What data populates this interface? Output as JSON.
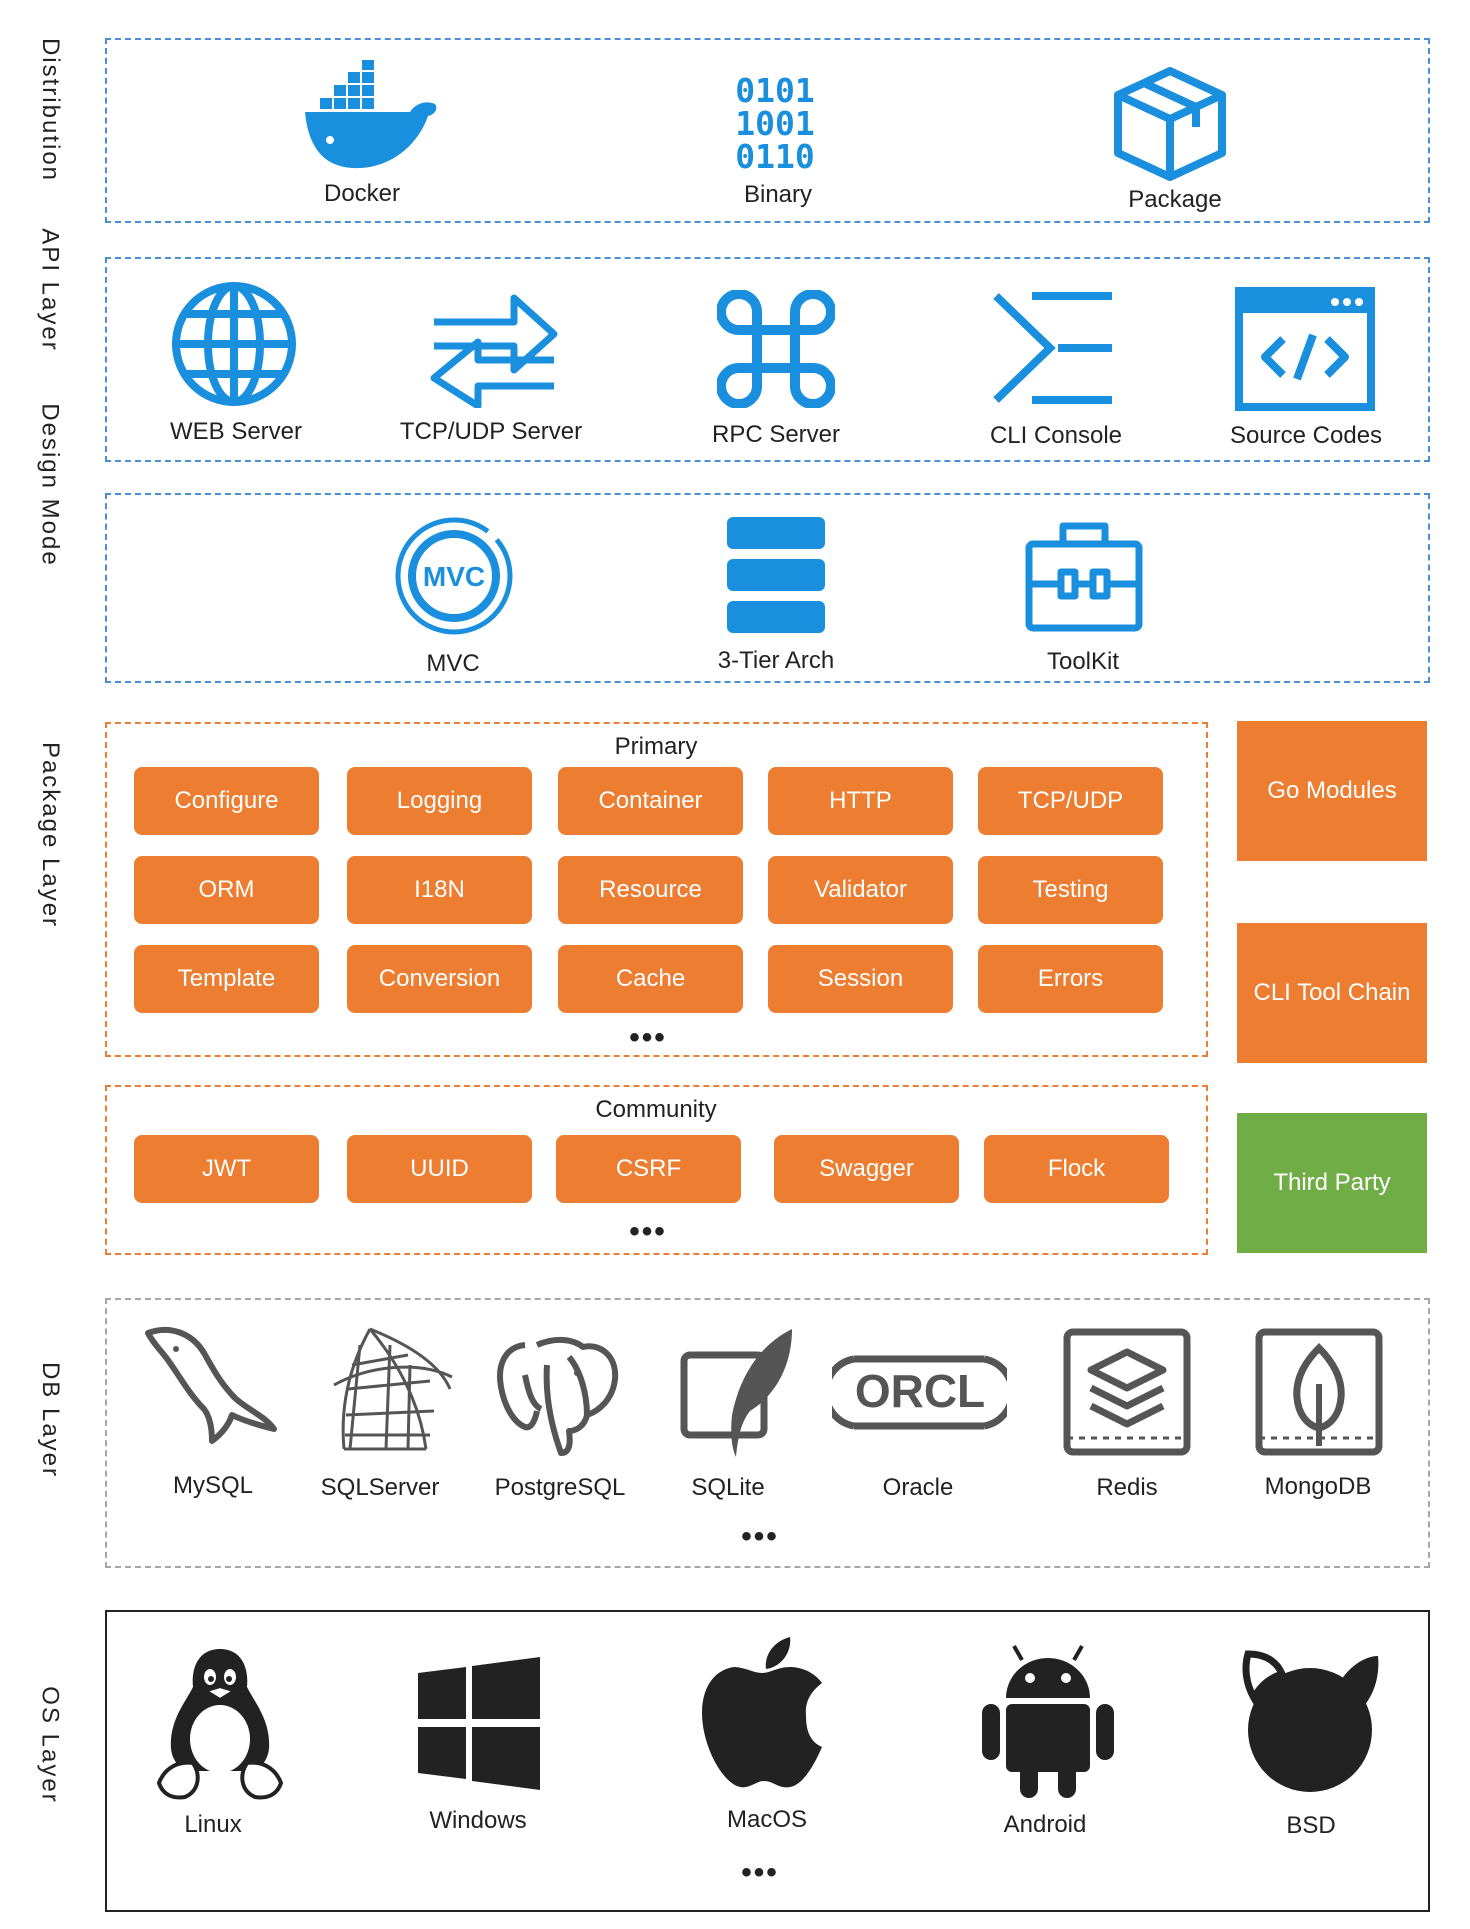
{
  "layers": {
    "distribution": "Distribution",
    "api": "API Layer",
    "design": "Design  Mode",
    "package": "Package  Layer",
    "db": "DB  Layer",
    "os": "OS Layer"
  },
  "distribution": {
    "docker": "Docker",
    "binary": "Binary",
    "binary_icon_rows": [
      "0101",
      "1001",
      "0110"
    ],
    "package": "Package"
  },
  "api": {
    "web": "WEB Server",
    "tcpudp": "TCP/UDP Server",
    "rpc": "RPC Server",
    "cli": "CLI Console",
    "source": "Source Codes"
  },
  "design": {
    "mvc": "MVC",
    "mvc_badge": "MVC",
    "tier": "3-Tier Arch",
    "toolkit": "ToolKit"
  },
  "package": {
    "primary_heading": "Primary",
    "primary_items": [
      "Configure",
      "Logging",
      "Container",
      "HTTP",
      "TCP/UDP",
      "ORM",
      "I18N",
      "Resource",
      "Validator",
      "Testing",
      "Template",
      "Conversion",
      "Cache",
      "Session",
      "Errors"
    ],
    "community_heading": "Community",
    "community_items": [
      "JWT",
      "UUID",
      "CSRF",
      "Swagger",
      "Flock"
    ],
    "ellipsis": "•••",
    "side": {
      "go_modules": "Go Modules",
      "cli_tool_chain": "CLI Tool Chain",
      "third_party": "Third Party"
    }
  },
  "db": {
    "mysql": "MySQL",
    "sqlserver": "SQLServer",
    "postgres": "PostgreSQL",
    "sqlite": "SQLite",
    "oracle": "Oracle",
    "oracle_logo": "ORCL",
    "redis": "Redis",
    "mongodb": "MongoDB",
    "ellipsis": "•••"
  },
  "os": {
    "linux": "Linux",
    "windows": "Windows",
    "macos": "MacOS",
    "android": "Android",
    "bsd": "BSD",
    "ellipsis": "•••"
  },
  "colors": {
    "blue": "#1a8fdd",
    "orange": "#ed7d31",
    "green": "#70ad47",
    "grey": "#555555",
    "black": "#222222"
  }
}
